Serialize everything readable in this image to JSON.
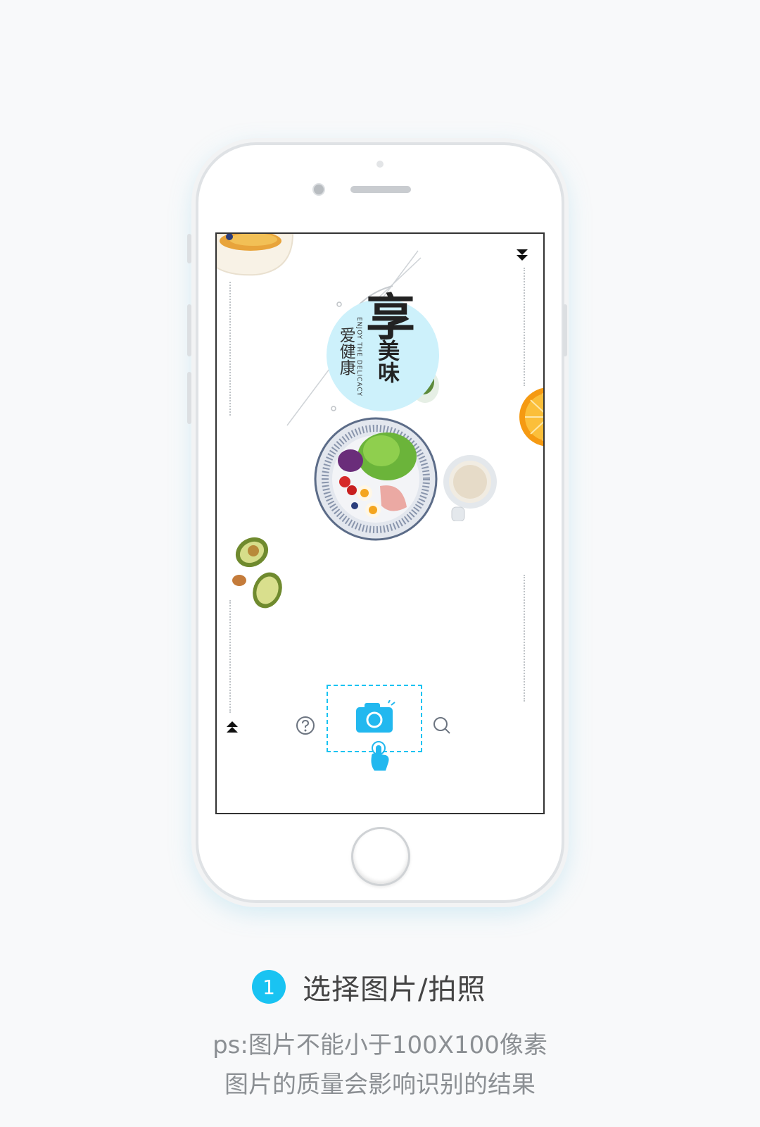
{
  "screen": {
    "title_main": "享",
    "title_sub1": "美味",
    "title_sub2": "爱健康",
    "title_en": "ENJOY THE DELICACY",
    "toolbar": {
      "help_icon": "question-circle-icon",
      "camera_icon": "camera-icon",
      "search_icon": "search-icon",
      "tap_icon": "tap-hand-icon"
    },
    "nav": {
      "down_icon": "double-arrow-down-icon",
      "up_icon": "double-arrow-up-icon"
    }
  },
  "step": {
    "number": "1",
    "label": "选择图片/拍照"
  },
  "notes": {
    "line1": "ps:图片不能小于100X100像素",
    "line2": "图片的质量会影响识别的结果"
  },
  "colors": {
    "accent": "#19c3f2",
    "title_circle": "#cdf1fb"
  }
}
